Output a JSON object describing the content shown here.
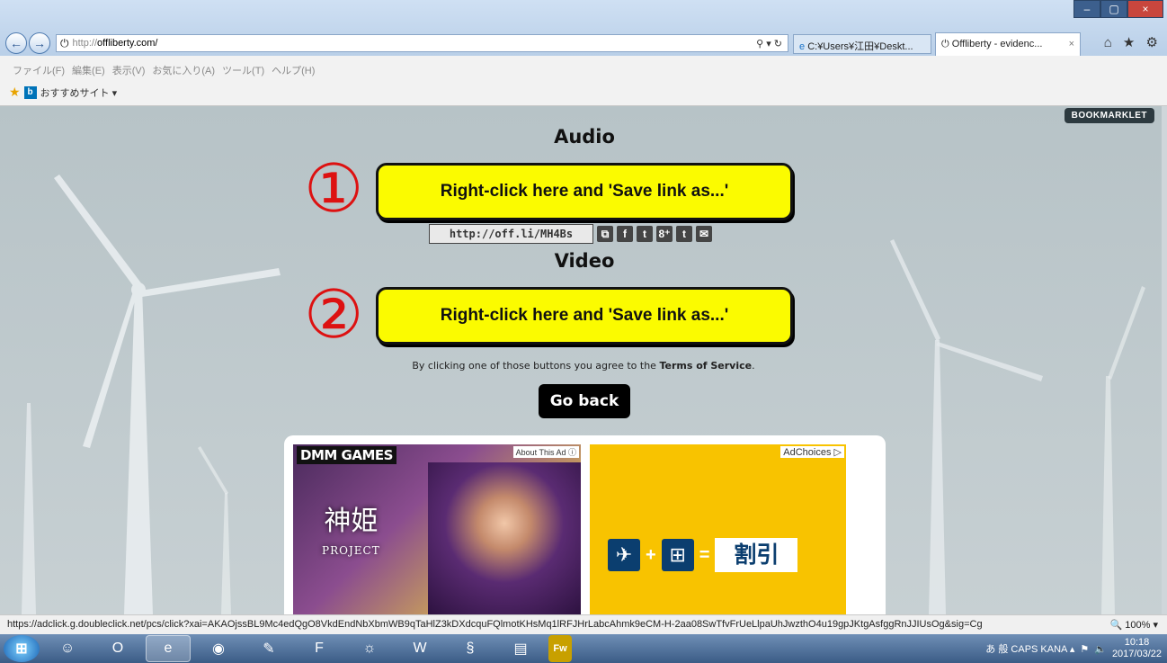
{
  "browser": {
    "url_scheme": "http://",
    "url_host": "offliberty.com/",
    "addr_tools": "⚲ ▾ ↻",
    "tab1_label": "C:¥Users¥江田¥Deskt...",
    "tab2_label": "Offliberty - evidenc...",
    "tab2_close": "×",
    "window_controls": [
      "–",
      "▢",
      "×"
    ],
    "right_icons": "⌂ ★ ⚙"
  },
  "menubar": {
    "items": [
      "ファイル(F)",
      "編集(E)",
      "表示(V)",
      "お気に入り(A)",
      "ツール(T)",
      "ヘルプ(H)"
    ]
  },
  "favbar": {
    "bing_letter": "b",
    "label": "おすすめサイト ▾"
  },
  "page": {
    "bookmarklet": "BOOKMARKLET",
    "audio_heading": "Audio",
    "video_heading": "Video",
    "audio_button": "Right-click here and 'Save link as...'",
    "video_button": "Right-click here and 'Save link as...'",
    "marker_1": "①",
    "marker_2": "②",
    "short_url": "http://off.li/MH4Bs",
    "share_icons": [
      "⧉",
      "f",
      "t",
      "8⁺",
      "t",
      "✉"
    ],
    "terms_prefix": "By clicking one of those buttons you agree to the ",
    "terms_link": "Terms of Service",
    "terms_suffix": ".",
    "go_back": "Go back"
  },
  "ads": {
    "ad1_brand": "DMM GAMES",
    "ad1_about": "About This Ad ⓘ",
    "ad1_title": "神姫",
    "ad1_subtitle": "PROJECT",
    "ad2_choices": "AdChoices ▷",
    "ad2_plus": "+",
    "ad2_eq": "=",
    "ad2_icon1": "✈",
    "ad2_icon2": "⊞",
    "ad2_result": "割引"
  },
  "statusbar": {
    "link": "https://adclick.g.doubleclick.net/pcs/click?xai=AKAOjssBL9Mc4edQgO8VkdEndNbXbmWB9qTaHlZ3kDXdcquFQlmotKHsMq1lRFJHrLabcAhmk9eCM-H-2aa08SwTfvFrUeLlpaUhJwzthO4u19gpJKtgAsfggRnJJIUsOg&sig=Cg",
    "zoom": "🔍 100%  ▾"
  },
  "taskbar": {
    "start_glyph": "⊞",
    "apps": [
      "☺",
      "O",
      "e",
      "◉",
      "✎",
      "F",
      "☼",
      "W",
      "§",
      "▤",
      "Fw"
    ],
    "tray_text": "あ 般 CAPS KANA ▴",
    "time": "10:18",
    "date": "2017/03/22"
  }
}
